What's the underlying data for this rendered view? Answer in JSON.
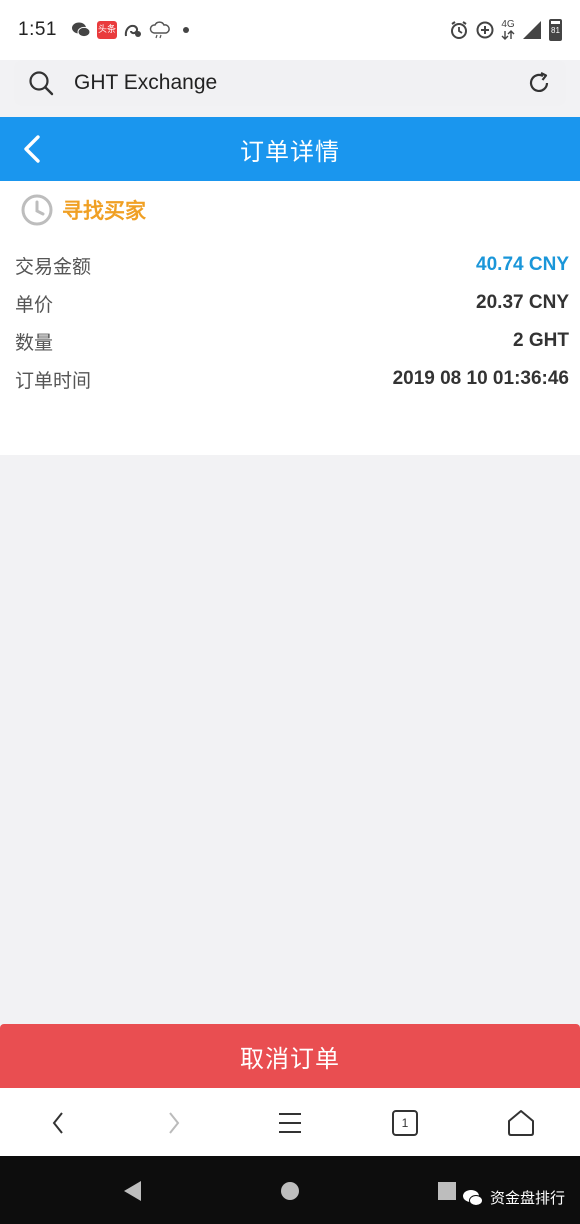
{
  "status_bar": {
    "time": "1:51",
    "toutiao_badge": "头条",
    "network": "4G",
    "battery": "81"
  },
  "browser": {
    "address": "GHT Exchange"
  },
  "header": {
    "title": "订单详情"
  },
  "order": {
    "status": "寻找买家",
    "rows": [
      {
        "label": "交易金额",
        "value": "40.74 CNY"
      },
      {
        "label": "单价",
        "value": "20.37 CNY"
      },
      {
        "label": "数量",
        "value": "2 GHT"
      },
      {
        "label": "订单时间",
        "value": "2019 08 10 01:36:46"
      }
    ]
  },
  "actions": {
    "cancel_label": "取消订单"
  },
  "toolbar": {
    "tab_count": "1"
  },
  "watermark": {
    "text": "资金盘排行"
  },
  "colors": {
    "header_blue": "#1a96ee",
    "status_orange": "#f0a024",
    "amount_blue": "#1a96d9",
    "cancel_red": "#e94e51"
  }
}
